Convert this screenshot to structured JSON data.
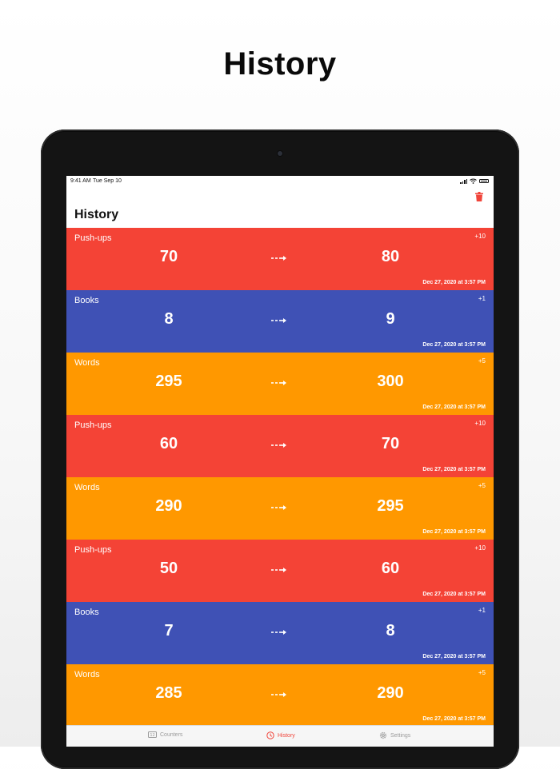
{
  "headline": "History",
  "status_bar": {
    "time": "9:41 AM",
    "date": "Tue Sep 10"
  },
  "nav": {
    "title": "History",
    "trash_icon": "trash-icon"
  },
  "colors": {
    "red": "#f44336",
    "blue": "#3f51b5",
    "orange": "#ff9800",
    "tab_active": "#f0443a",
    "tab_inactive": "#9a9a9a"
  },
  "history": [
    {
      "name": "Push-ups",
      "delta": "+10",
      "old": "70",
      "new": "80",
      "date": "Dec 27, 2020 at 3:57 PM",
      "color": "#f44336"
    },
    {
      "name": "Books",
      "delta": "+1",
      "old": "8",
      "new": "9",
      "date": "Dec 27, 2020 at 3:57 PM",
      "color": "#3f51b5"
    },
    {
      "name": "Words",
      "delta": "+5",
      "old": "295",
      "new": "300",
      "date": "Dec 27, 2020 at 3:57 PM",
      "color": "#ff9800"
    },
    {
      "name": "Push-ups",
      "delta": "+10",
      "old": "60",
      "new": "70",
      "date": "Dec 27, 2020 at 3:57 PM",
      "color": "#f44336"
    },
    {
      "name": "Words",
      "delta": "+5",
      "old": "290",
      "new": "295",
      "date": "Dec 27, 2020 at 3:57 PM",
      "color": "#ff9800"
    },
    {
      "name": "Push-ups",
      "delta": "+10",
      "old": "50",
      "new": "60",
      "date": "Dec 27, 2020 at 3:57 PM",
      "color": "#f44336"
    },
    {
      "name": "Books",
      "delta": "+1",
      "old": "7",
      "new": "8",
      "date": "Dec 27, 2020 at 3:57 PM",
      "color": "#3f51b5"
    },
    {
      "name": "Words",
      "delta": "+5",
      "old": "285",
      "new": "290",
      "date": "Dec 27, 2020 at 3:57 PM",
      "color": "#ff9800"
    }
  ],
  "tabs": [
    {
      "label": "Counters",
      "icon": "counter-icon"
    },
    {
      "label": "History",
      "icon": "clock-icon",
      "active": true
    },
    {
      "label": "Settings",
      "icon": "gear-icon"
    }
  ]
}
